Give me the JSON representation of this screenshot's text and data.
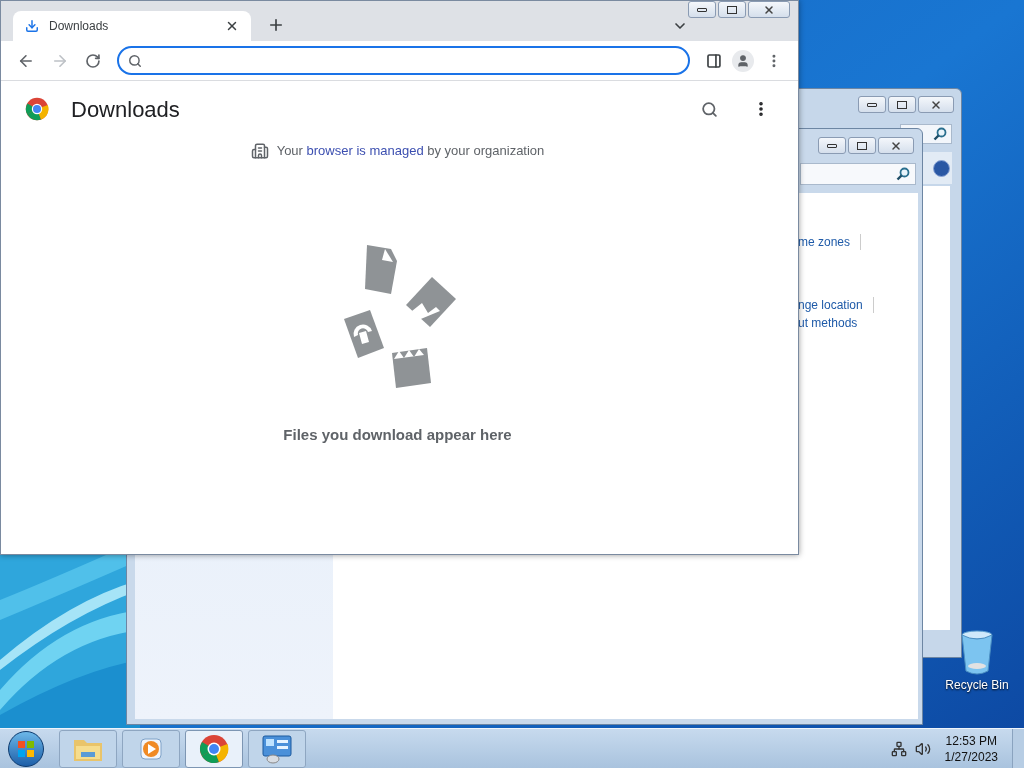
{
  "browser": {
    "tabs": [
      {
        "label": "Downloads",
        "selected": true
      }
    ],
    "page": {
      "title": "Downloads",
      "notice": {
        "before": "Your",
        "link": "browser is managed",
        "after": "by your organization"
      },
      "empty_message": "Files you download appear here"
    }
  },
  "background_windows": {
    "links": [
      "me zones",
      "nge location",
      "ut methods"
    ]
  },
  "desktop_icons": [
    {
      "label": "Recycle Bin"
    }
  ],
  "taskbar": {
    "buttons": [
      {
        "kind": "explorer",
        "selected": false
      },
      {
        "kind": "media",
        "selected": false
      },
      {
        "kind": "chrome",
        "selected": true
      },
      {
        "kind": "control-panel",
        "selected": false
      }
    ],
    "clock": {
      "time": "12:53 PM",
      "date": "1/27/2023"
    }
  }
}
